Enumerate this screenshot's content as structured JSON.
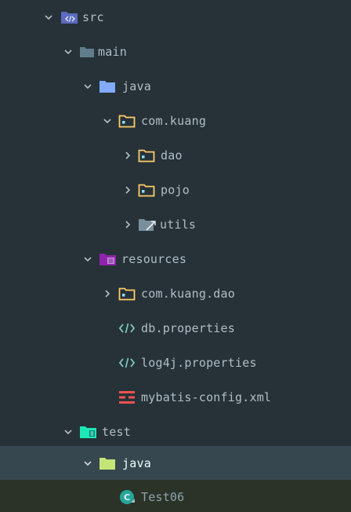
{
  "tree": {
    "items": [
      {
        "label": "src",
        "icon": "source-folder-icon",
        "expanded": true
      },
      {
        "label": "main",
        "icon": "folder-icon",
        "expanded": true
      },
      {
        "label": "java",
        "icon": "java-source-folder-icon",
        "expanded": true
      },
      {
        "label": "com.kuang",
        "icon": "package-icon",
        "expanded": true
      },
      {
        "label": "dao",
        "icon": "package-icon",
        "expanded": false
      },
      {
        "label": "pojo",
        "icon": "package-icon",
        "expanded": false
      },
      {
        "label": "utils",
        "icon": "package-utils-icon",
        "expanded": false
      },
      {
        "label": "resources",
        "icon": "resources-folder-icon",
        "expanded": true
      },
      {
        "label": "com.kuang.dao",
        "icon": "package-icon",
        "expanded": false
      },
      {
        "label": "db.properties",
        "icon": "properties-file-icon"
      },
      {
        "label": "log4j.properties",
        "icon": "properties-file-icon"
      },
      {
        "label": "mybatis-config.xml",
        "icon": "xml-file-icon"
      },
      {
        "label": "test",
        "icon": "test-folder-icon",
        "expanded": true
      },
      {
        "label": "java",
        "icon": "test-java-folder-icon",
        "expanded": true,
        "selected": true
      },
      {
        "label": "Test06",
        "icon": "java-class-icon"
      }
    ]
  },
  "colors": {
    "background": "#263238",
    "selection": "#37474f",
    "folder_blue": "#82aaff",
    "package_orange": "#ffcb6b",
    "test_green": "#1de9b6",
    "resources_purple": "#ab47bc",
    "xml_red": "#ef5350",
    "properties_cyan": "#80cbc4",
    "test_java_green": "#c5e478"
  }
}
